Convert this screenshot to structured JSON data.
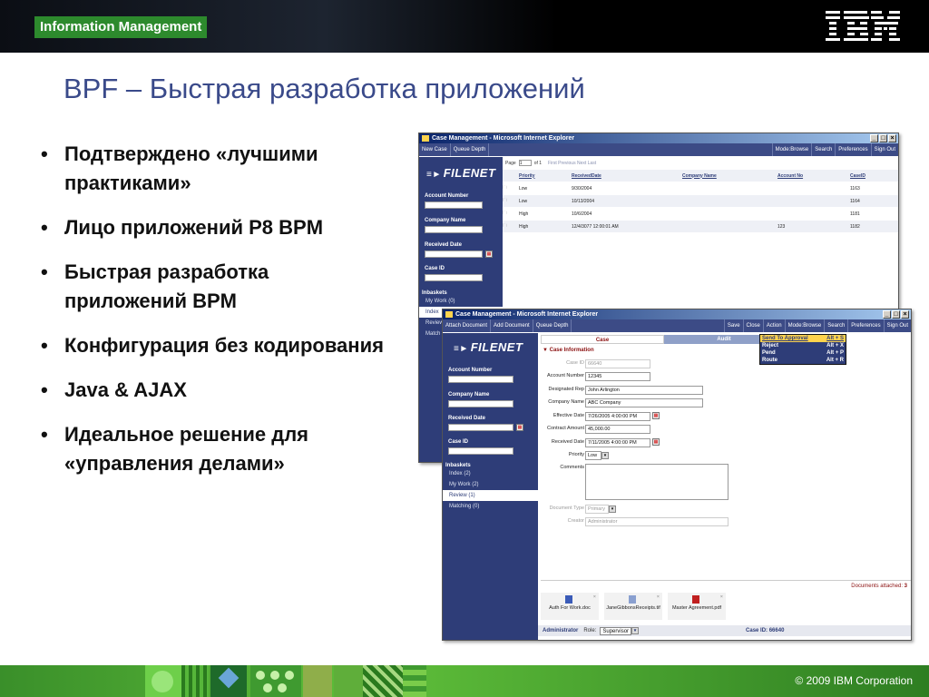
{
  "slide": {
    "brand": "Information Management",
    "ibm_logo": "IBM",
    "title": "BPF – Быстрая разработка приложений",
    "bullets": [
      "Подтверждено «лучшими практиками»",
      "Лицо приложений P8 BPM",
      "Быстрая разработка приложений BPM",
      "Конфигурация без кодирования",
      "Java & AJAX",
      "Идеальное решение для «управления делами»"
    ],
    "copyright": "© 2009  IBM Corporation"
  },
  "back_window": {
    "title": "Case Management - Microsoft Internet Explorer",
    "toolbar_left": [
      "New Case",
      "Queue Depth"
    ],
    "toolbar_right": [
      "Mode:Browse",
      "Search",
      "Preferences",
      "Sign Out"
    ],
    "logo": "FILENET",
    "fields": [
      "Account Number",
      "Company Name",
      "Received Date",
      "Case ID"
    ],
    "inbaskets_label": "Inbaskets",
    "inbaskets": [
      "My Work (0)",
      "Index",
      "Review",
      "Match"
    ],
    "pager": {
      "page_label": "Page",
      "page_value": "1",
      "of_label": "of 1",
      "nav": "First  Previous  Next  Last"
    },
    "columns": [
      "Priority",
      "ReceivedDate",
      "Company Name",
      "Account No",
      "CaseID"
    ],
    "rows": [
      [
        "Low",
        "9/30/2004",
        "",
        "",
        "1163"
      ],
      [
        "Low",
        "10/13/2004",
        "",
        "",
        "1164"
      ],
      [
        "High",
        "10/6/2004",
        "",
        "",
        "1181"
      ],
      [
        "High",
        "12/4/3077 12:00:01 AM",
        "",
        "123",
        "1182"
      ]
    ]
  },
  "front_window": {
    "title": "Case Management - Microsoft Internet Explorer",
    "toolbar_left": [
      "Attach Document",
      "Add Document",
      "Queue Depth"
    ],
    "toolbar_right": [
      "Save",
      "Close",
      "Action",
      "Mode:Browse",
      "Search",
      "Preferences",
      "Sign Out"
    ],
    "logo": "FILENET",
    "fields": [
      "Account Number",
      "Company Name",
      "Received Date",
      "Case ID"
    ],
    "inbaskets_label": "Inbaskets",
    "inbaskets": [
      "Index (2)",
      "My Work (2)",
      "Review (1)",
      "Matching (0)"
    ],
    "selected_inbasket": "Review (1)",
    "tabs": [
      "Case",
      "Audit"
    ],
    "section": "Case Information",
    "form": [
      {
        "label": "Case ID",
        "value": "66640",
        "dim": true
      },
      {
        "label": "Account Number",
        "value": "12345"
      },
      {
        "label": "Designated Rep",
        "value": "John Arlington"
      },
      {
        "label": "Company Name",
        "value": "ABC Company"
      },
      {
        "label": "Effective Date",
        "value": "7/26/2005 4:00:00 PM"
      },
      {
        "label": "Contract Amount",
        "value": "45,000.00"
      },
      {
        "label": "Received Date",
        "value": "7/11/2005 4:00:00 PM"
      },
      {
        "label": "Priority",
        "value": "Low"
      },
      {
        "label": "Comments",
        "value": ""
      },
      {
        "label": "Document Type",
        "value": "Primary",
        "dim": true
      },
      {
        "label": "Creator",
        "value": "Administrator",
        "dim": true
      }
    ],
    "action_menu": [
      {
        "label": "Send To Approval",
        "key": "Alt + S"
      },
      {
        "label": "Reject",
        "key": "Alt + X"
      },
      {
        "label": "Pend",
        "key": "Alt + P"
      },
      {
        "label": "Route",
        "key": "Alt + R"
      }
    ],
    "documents_attached_label": "Documents attached:",
    "documents_attached_count": "3",
    "documents": [
      "Auth For Work.doc",
      "JaneGibbonsReceipts.tif",
      "Master Agreement.pdf"
    ],
    "status": {
      "user": "Administrator",
      "role_label": "Role:",
      "role": "Supervisor",
      "case_label": "Case ID: 66640"
    }
  }
}
